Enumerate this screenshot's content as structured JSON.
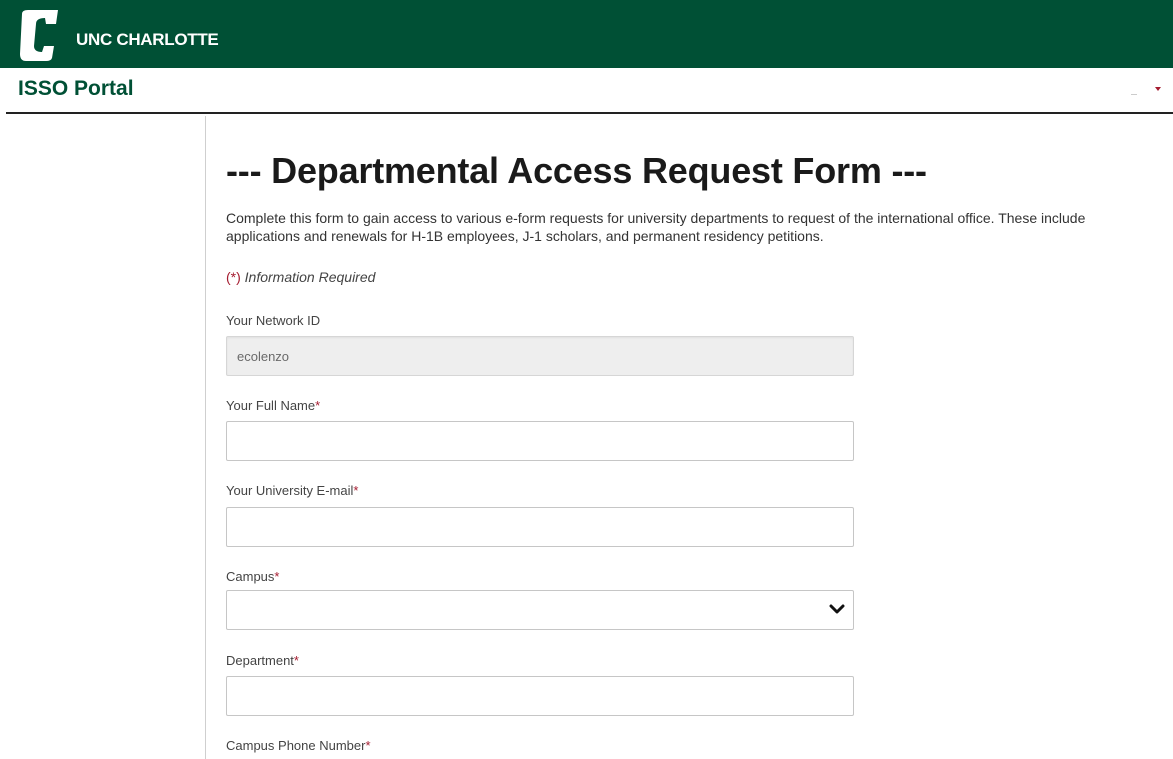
{
  "header": {
    "brand_name": "UNC CHARLOTTE",
    "logo_icon": "unc-charlotte-c-logo",
    "brand_color": "#005035"
  },
  "portal": {
    "title": "ISSO Portal",
    "menu_icon": "caret-down-icon",
    "accent_color": "#a51c30"
  },
  "form": {
    "title": "--- Departmental Access Request Form ---",
    "intro": "Complete this form to gain access to various e-form requests for university departments to request of the international office. These include applications and renewals for H-1B employees, J-1 scholars, and permanent residency petitions.",
    "required_marker": "(*)",
    "required_note": "Information Required",
    "fields": {
      "network_id": {
        "label": "Your Network ID",
        "value": "ecolenzo"
      },
      "full_name": {
        "label": "Your Full Name",
        "required": "*",
        "value": ""
      },
      "email": {
        "label": "Your University E-mail",
        "required": "*",
        "value": ""
      },
      "campus": {
        "label": "Campus",
        "required": "*",
        "selected": "",
        "icon": "chevron-down-icon"
      },
      "department": {
        "label": "Department",
        "required": "*",
        "value": ""
      },
      "phone": {
        "label": "Campus Phone Number",
        "required": "*"
      }
    }
  }
}
